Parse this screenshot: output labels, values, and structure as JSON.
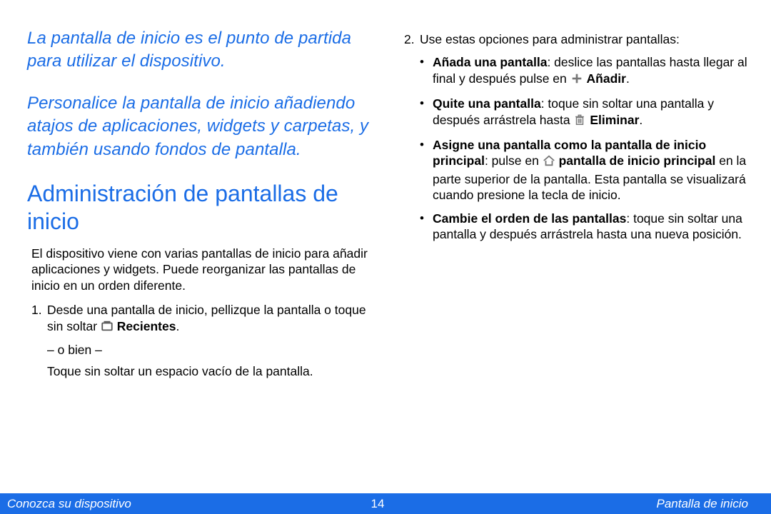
{
  "left": {
    "intro1": "La pantalla de inicio es el punto de partida para utilizar el dispositivo.",
    "intro2": "Personalice la pantalla de inicio añadiendo atajos de aplicaciones, widgets y carpetas, y también usando fondos de pantalla.",
    "heading": "Administración de pantallas de inicio",
    "body": "El dispositivo viene con varias pantallas de inicio para añadir aplicaciones y widgets. Puede reorganizar las pantallas de inicio en un orden diferente.",
    "step1_num": "1.",
    "step1_a": "Desde una pantalla de inicio, pellizque la pantalla o toque sin soltar ",
    "step1_recent_bold": " Recientes",
    "step1_dot": ".",
    "step1_or": "– o bien –",
    "step1_b": "Toque sin soltar un espacio vacío de la pantalla."
  },
  "right": {
    "step2_num": "2.",
    "step2_lead": "Use estas opciones para administrar pantallas:",
    "b1_bold": "Añada una pantalla",
    "b1_rest1": ": deslice las pantallas hasta llegar al final y después pulse en ",
    "b1_add_bold": " Añadir",
    "b1_dot": ".",
    "b2_bold": "Quite una pantalla",
    "b2_rest1": ": toque sin soltar una pantalla y después arrástrela hasta ",
    "b2_del_bold": " Eliminar",
    "b2_dot": ".",
    "b3_bold1": "Asigne una pantalla como la pantalla de inicio principal",
    "b3_rest1": ": pulse en ",
    "b3_bold2": " pantalla de inicio principal",
    "b3_rest2": " en la parte superior de la pantalla. Esta pantalla se visualizará cuando presione la tecla de inicio.",
    "b4_bold": "Cambie el orden de las pantallas",
    "b4_rest": ": toque sin soltar una pantalla y después arrástrela hasta una nueva posición."
  },
  "footer": {
    "left": "Conozca su dispositivo",
    "center": "14",
    "right": "Pantalla de inicio"
  }
}
